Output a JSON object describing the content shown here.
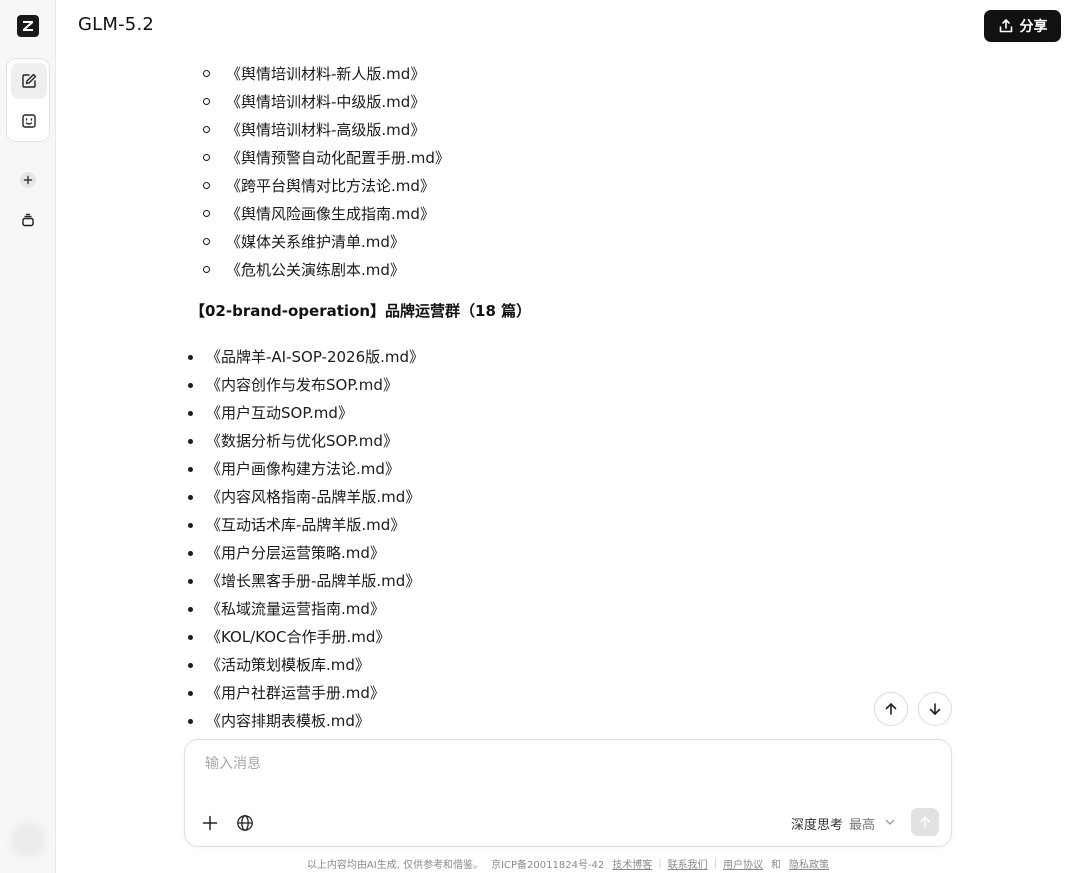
{
  "header": {
    "title": "GLM-5.2",
    "share_label": "分享"
  },
  "sidebar": {
    "logo_letter": "Z",
    "items": [
      {
        "name": "new-chat",
        "icon": "edit-icon"
      },
      {
        "name": "agent",
        "icon": "robot-face-icon"
      },
      {
        "name": "add",
        "icon": "plus-circle-icon"
      },
      {
        "name": "library",
        "icon": "stack-icon"
      }
    ]
  },
  "content": {
    "sub_items": [
      "《舆情培训材料-新人版.md》",
      "《舆情培训材料-中级版.md》",
      "《舆情培训材料-高级版.md》",
      "《舆情预警自动化配置手册.md》",
      "《跨平台舆情对比方法论.md》",
      "《舆情风险画像生成指南.md》",
      "《媒体关系维护清单.md》",
      "《危机公关演练剧本.md》"
    ],
    "section_title": "【02-brand-operation】品牌运营群（18 篇）",
    "items": [
      "《品牌羊-AI-SOP-2026版.md》",
      "《内容创作与发布SOP.md》",
      "《用户互动SOP.md》",
      "《数据分析与优化SOP.md》",
      "《用户画像构建方法论.md》",
      "《内容风格指南-品牌羊版.md》",
      "《互动话术库-品牌羊版.md》",
      "《用户分层运营策略.md》",
      "《增长黑客手册-品牌羊版.md》",
      "《私域流量运营指南.md》",
      "《KOL/KOC合作手册.md》",
      "《活动策划模板库.md》",
      "《用户社群运营手册.md》",
      "《内容排期表模板.md》"
    ]
  },
  "composer": {
    "placeholder": "输入消息",
    "value": "",
    "mode_label": "深度思考",
    "mode_value": "最高"
  },
  "footer": {
    "notice": "以上内容均由AI生成, 仅供参考和借鉴。",
    "icp": "京ICP备20011824号-42",
    "link_tech_blog": "技术博客",
    "link_contact": "联系我们",
    "link_user_agreement": "用户协议",
    "and": "和",
    "link_privacy": "隐私政策"
  },
  "colors": {
    "accent": "#111111",
    "sidebar_bg": "#f7f7f7",
    "border": "#e0e0e0"
  }
}
